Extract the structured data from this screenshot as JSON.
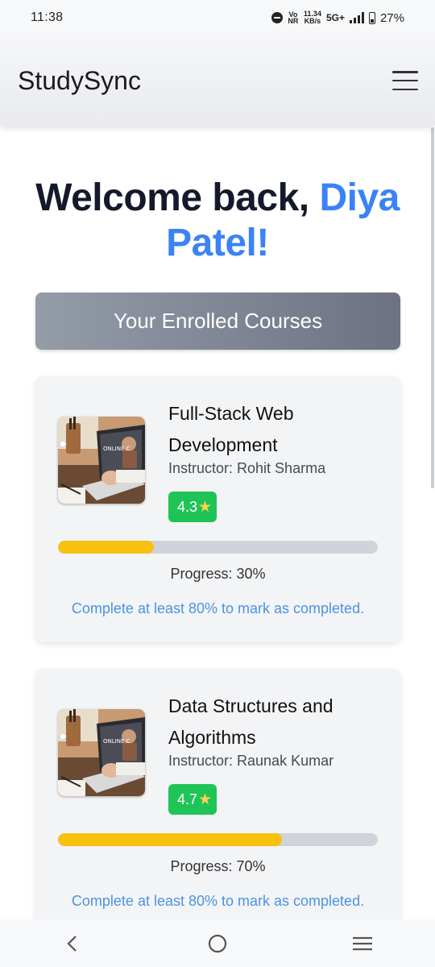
{
  "status_bar": {
    "time": "11:38",
    "volte_top": "Vo",
    "volte_bottom": "NR",
    "speed_value": "11.34",
    "speed_unit": "KB/s",
    "network": "5G+",
    "battery": "27%"
  },
  "header": {
    "brand": "StudySync",
    "menu_icon": "hamburger-menu-icon"
  },
  "welcome": {
    "greeting": "Welcome back,",
    "name_line1": "Diya",
    "name_line2": "Patel!"
  },
  "section": {
    "title": "Your Enrolled Courses"
  },
  "courses": [
    {
      "title": "Full-Stack Web Development",
      "instructor": "Instructor: Rohit Sharma",
      "rating": "4.3",
      "progress": 30,
      "progress_label": "Progress: 30%",
      "note": "Complete at least 80% to mark as completed.",
      "thumb_text": "ONLINE C"
    },
    {
      "title": "Data Structures and Algorithms",
      "instructor": "Instructor: Raunak Kumar",
      "rating": "4.7",
      "progress": 70,
      "progress_label": "Progress: 70%",
      "note": "Complete at least 80% to mark as completed.",
      "thumb_text": "ONLINE C"
    }
  ],
  "colors": {
    "accent_blue": "#3b82f6",
    "rating_green": "#1fc456",
    "progress_yellow": "#f7c10f",
    "note_blue": "#4a94e3"
  },
  "nav": {
    "back_icon": "back-chevron-icon",
    "home_icon": "home-circle-icon",
    "recents_icon": "recents-lines-icon"
  }
}
